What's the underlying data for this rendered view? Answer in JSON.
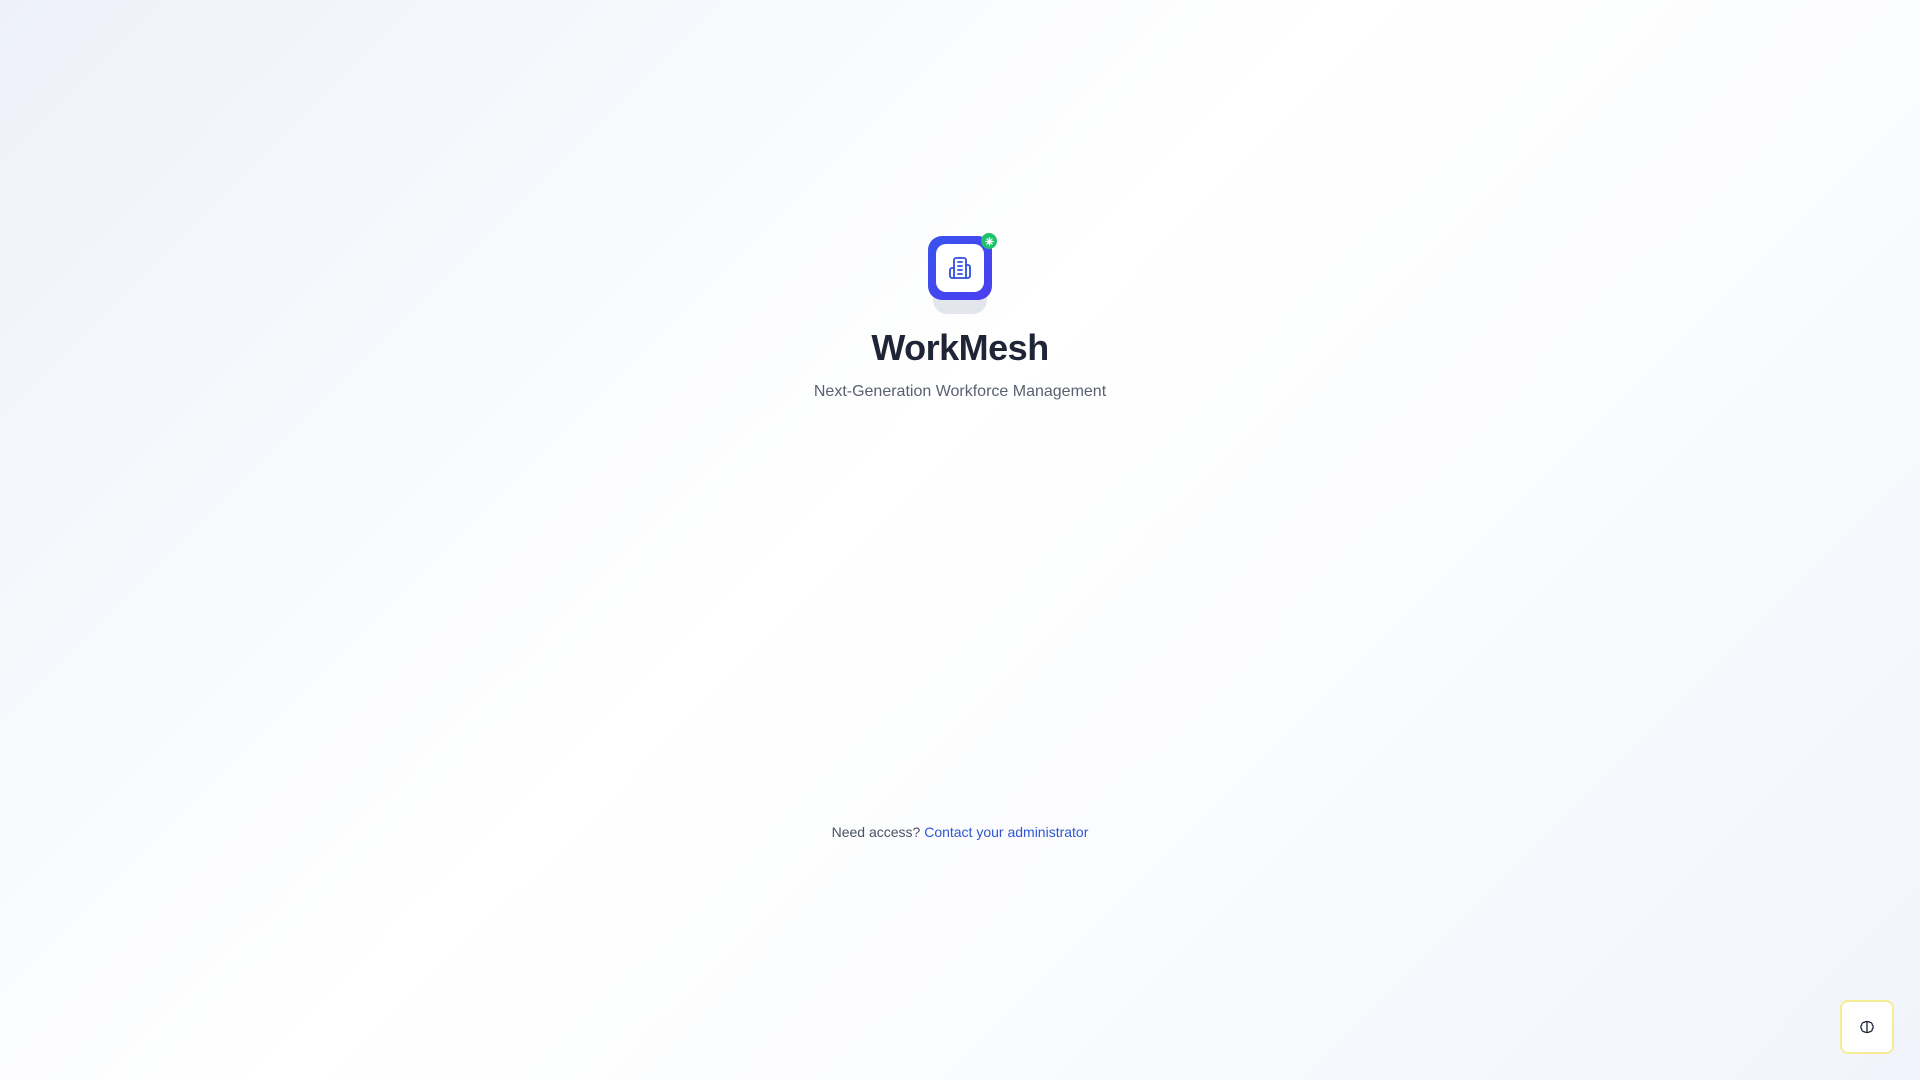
{
  "brand": {
    "app_name": "WorkMesh",
    "tagline": "Next-Generation Workforce Management",
    "logo_icon": "building-icon",
    "status_icon": "sparkle-icon",
    "colors": {
      "logo_primary": "#3a52f0",
      "status_badge": "#1fc16b",
      "title": "#1f2537"
    }
  },
  "footer": {
    "prompt": "Need access?",
    "link_label": "Contact your administrator",
    "link_color": "#2f55d4"
  },
  "theme_toggle": {
    "icon": "brain-icon",
    "border_color": "#f5ec93"
  }
}
